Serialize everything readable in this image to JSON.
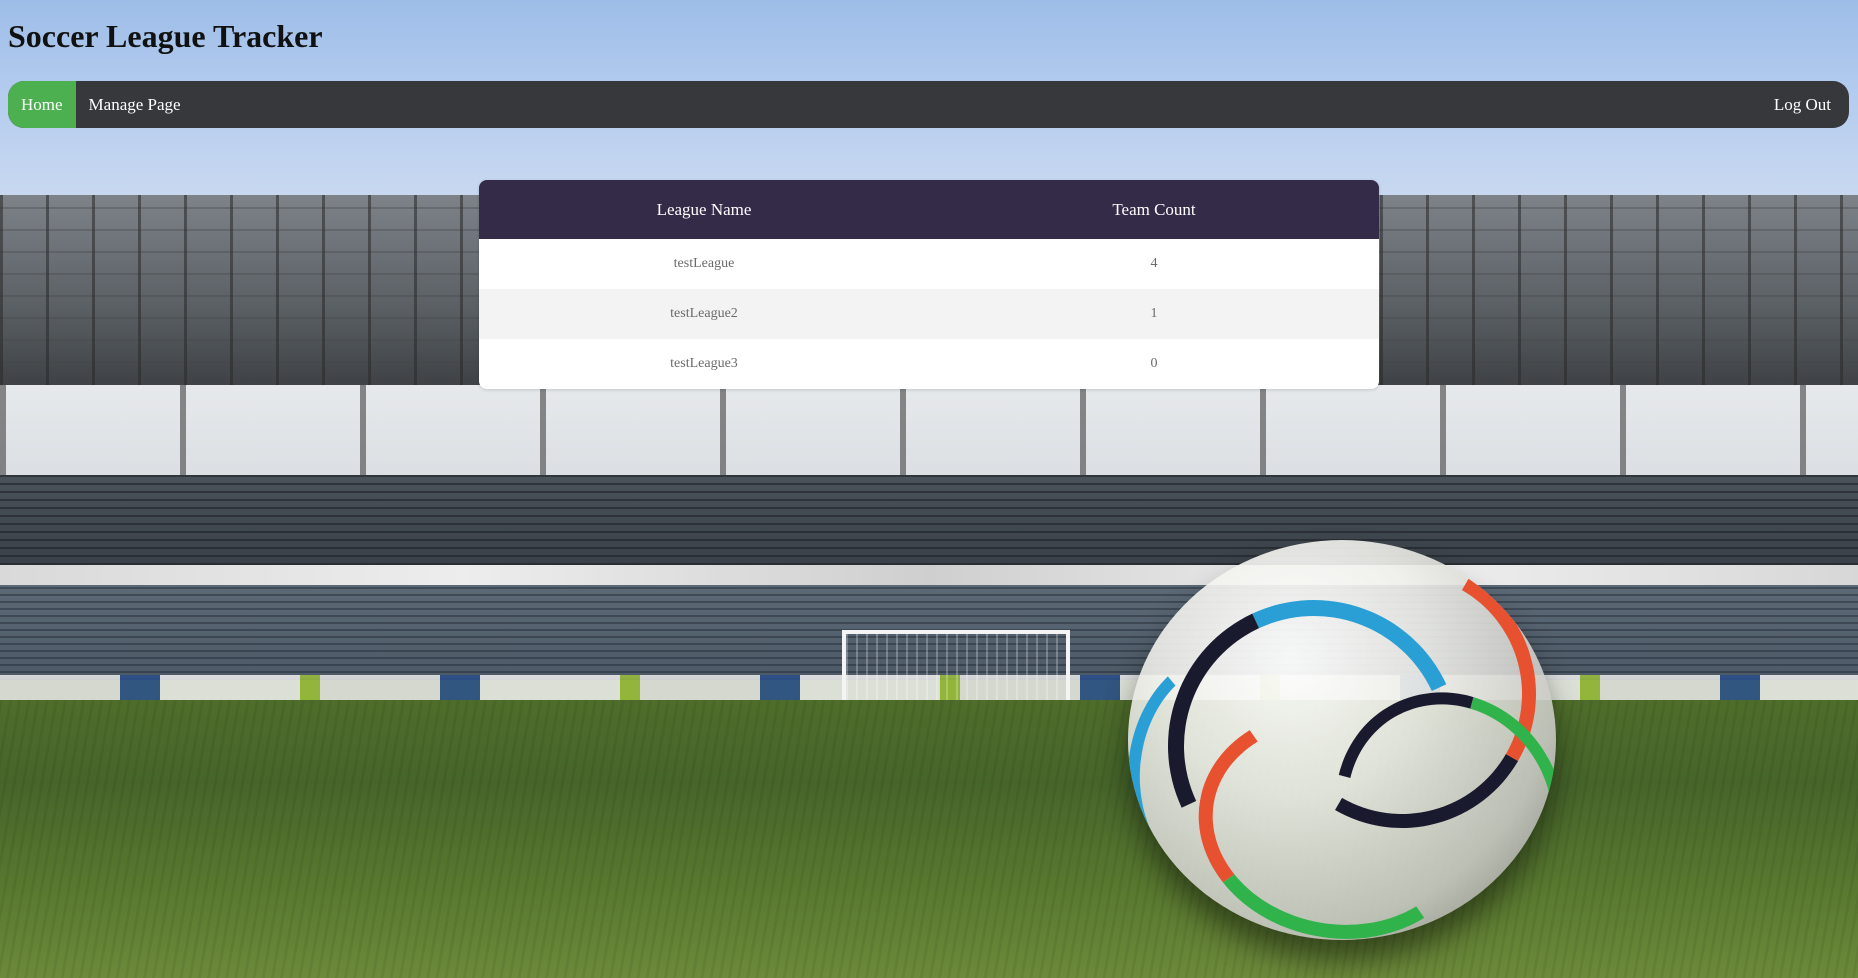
{
  "app": {
    "title": "Soccer League Tracker"
  },
  "nav": {
    "items": [
      {
        "label": "Home",
        "active": true
      },
      {
        "label": "Manage Page",
        "active": false
      }
    ],
    "logout_label": "Log Out"
  },
  "table": {
    "headers": [
      "League Name",
      "Team Count"
    ],
    "rows": [
      {
        "league": "testLeague",
        "count": "4"
      },
      {
        "league": "testLeague2",
        "count": "1"
      },
      {
        "league": "testLeague3",
        "count": "0"
      }
    ]
  },
  "colors": {
    "nav_bg": "#37383c",
    "nav_active": "#4caf50",
    "table_header": "#332b48"
  },
  "background": {
    "icon": "soccer-stadium-photo"
  }
}
